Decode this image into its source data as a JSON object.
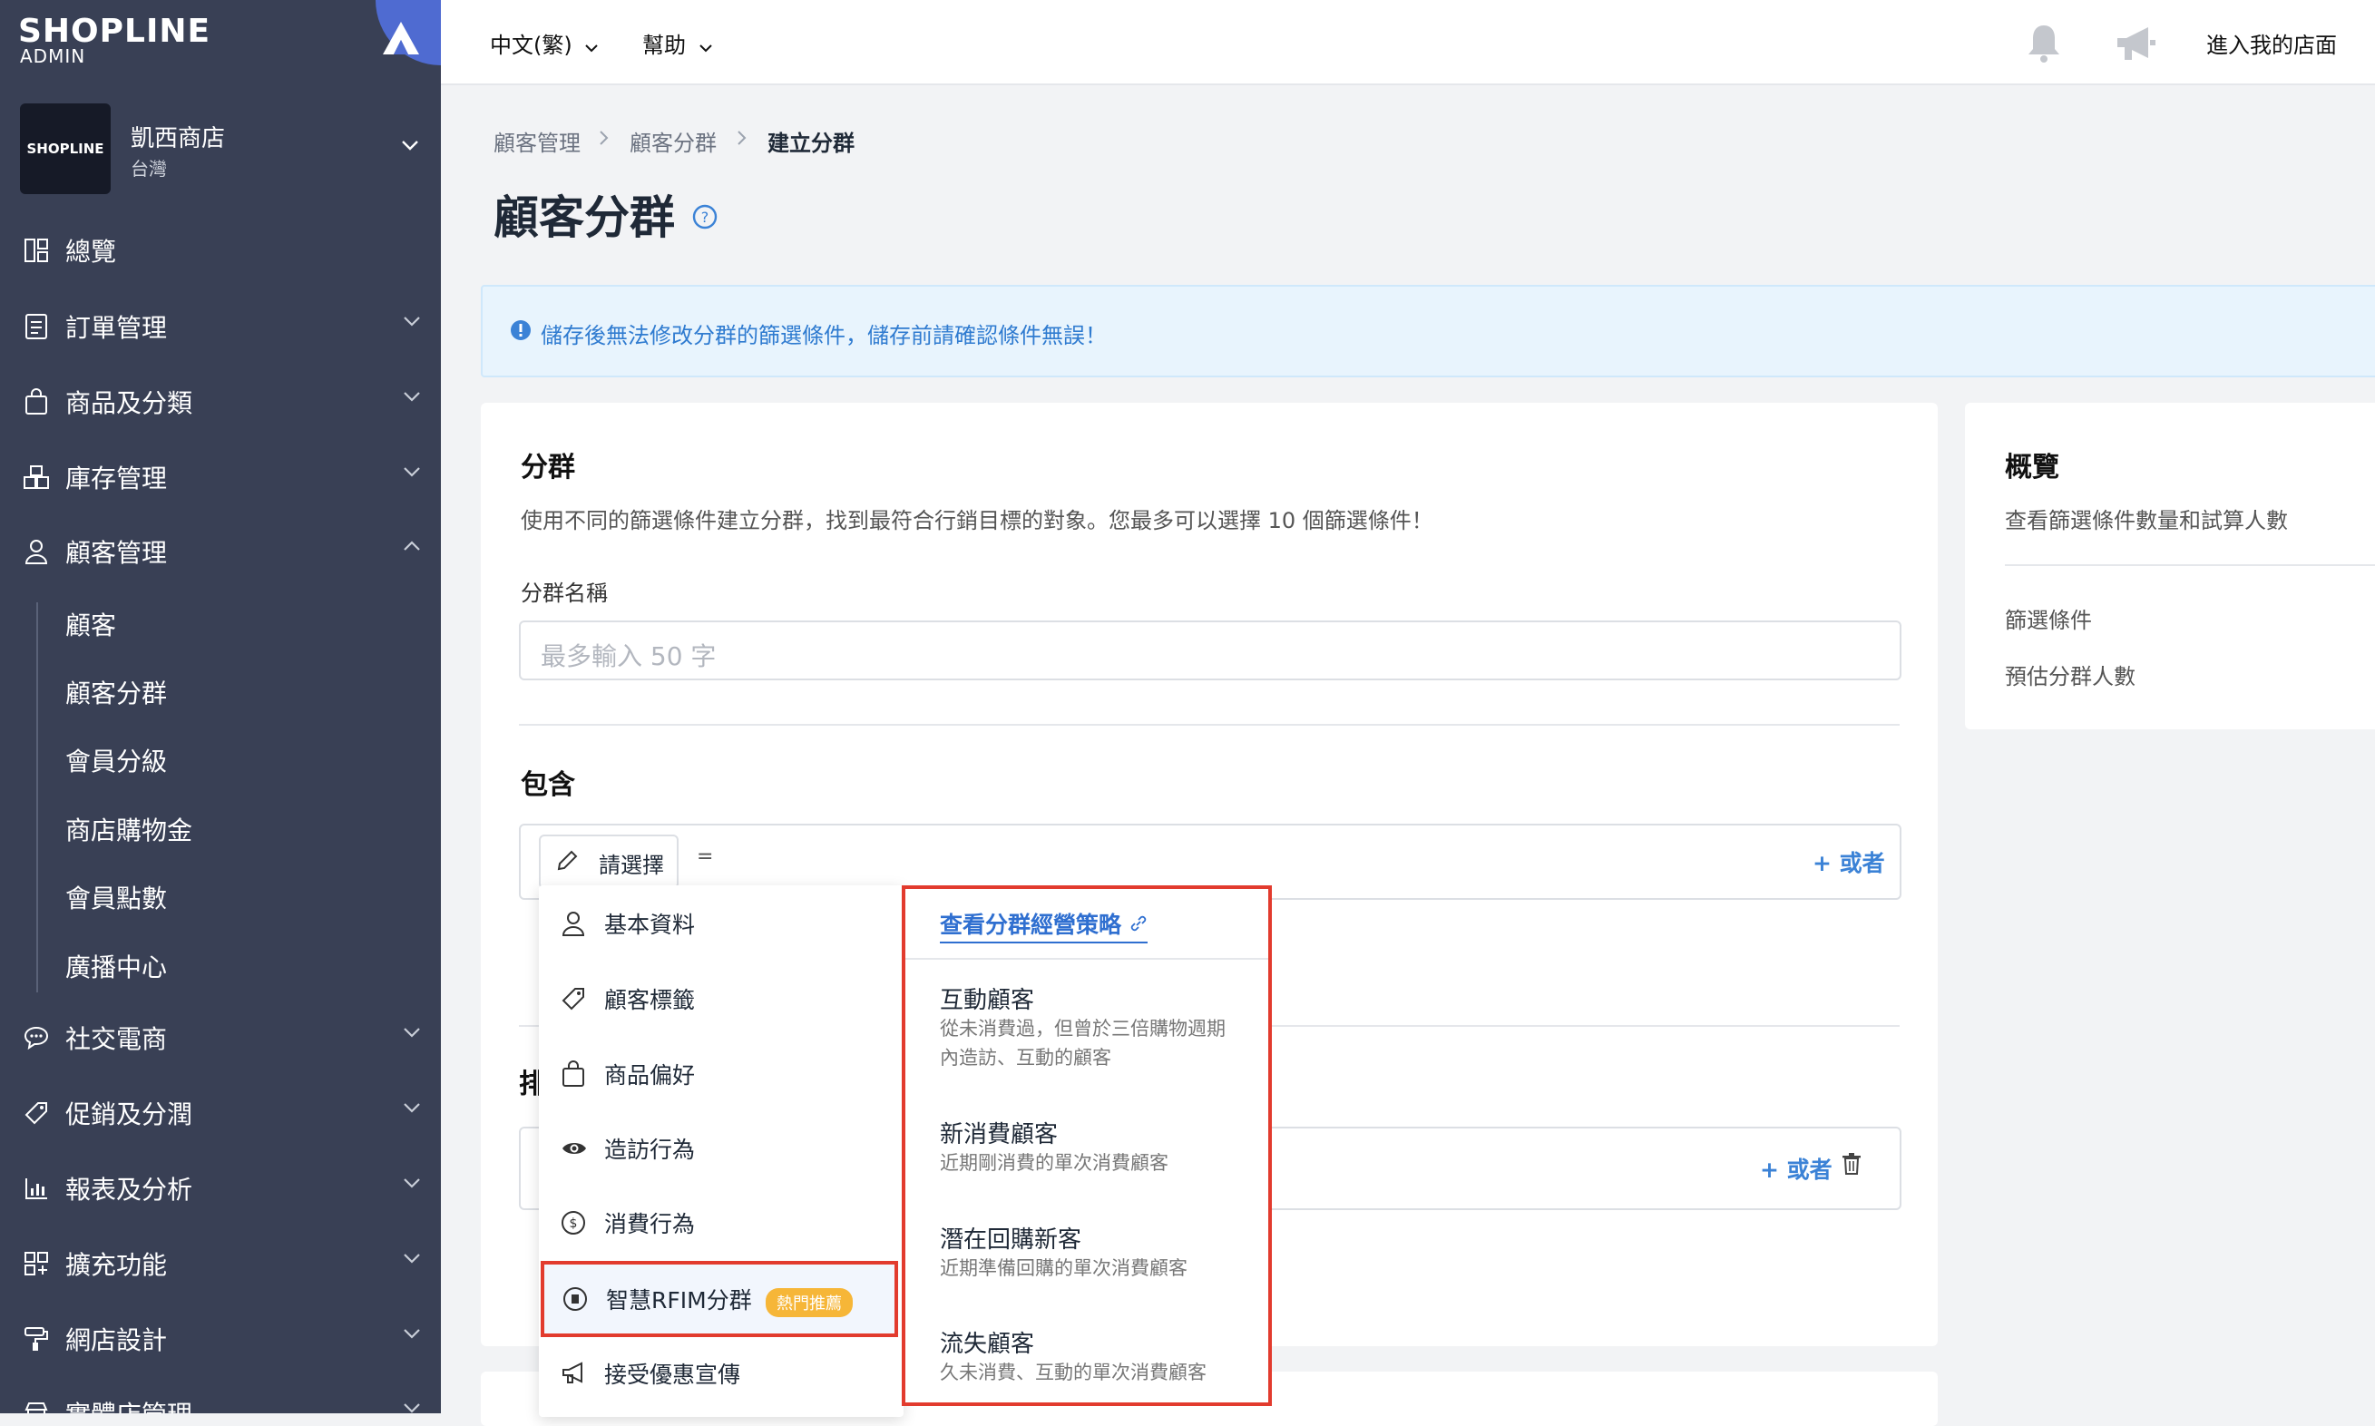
{
  "brand": {
    "logo": "SHOPLINE",
    "sub": "ADMIN",
    "store_logo": "SHOPLINE"
  },
  "store": {
    "name": "凱西商店",
    "region": "台灣"
  },
  "sidebar": {
    "items": [
      {
        "label": "總覽",
        "icon": "dashboard-icon"
      },
      {
        "label": "訂單管理",
        "icon": "order-icon"
      },
      {
        "label": "商品及分類",
        "icon": "bag-icon"
      },
      {
        "label": "庫存管理",
        "icon": "inventory-icon"
      },
      {
        "label": "顧客管理",
        "icon": "user-icon"
      },
      {
        "label": "社交電商",
        "icon": "chat-icon"
      },
      {
        "label": "促銷及分潤",
        "icon": "tag-icon"
      },
      {
        "label": "報表及分析",
        "icon": "chart-icon"
      },
      {
        "label": "擴充功能",
        "icon": "apps-icon"
      },
      {
        "label": "網店設計",
        "icon": "paint-roller-icon"
      },
      {
        "label": "實體店管理",
        "icon": "store-icon"
      }
    ],
    "sub_items": [
      "顧客",
      "顧客分群",
      "會員分級",
      "商店購物金",
      "會員點數",
      "廣播中心"
    ]
  },
  "topbar": {
    "language": "中文(繁)",
    "help": "幫助",
    "enter_store": "進入我的店面"
  },
  "breadcrumb": [
    "顧客管理",
    "顧客分群",
    "建立分群"
  ],
  "page": {
    "title": "顧客分群"
  },
  "alert": {
    "text": "儲存後無法修改分群的篩選條件，儲存前請確認條件無誤！"
  },
  "segment": {
    "heading": "分群",
    "description": "使用不同的篩選條件建立分群，找到最符合行銷目標的對象。您最多可以選擇 10 個篩選條件！",
    "name_label": "分群名稱",
    "name_placeholder": "最多輸入 50 字",
    "include_heading": "包含",
    "select_label": "請選擇",
    "equals": "=",
    "or_label": "+ 或者",
    "exclude_heading": "排"
  },
  "overview": {
    "heading": "概覽",
    "description": "查看篩選條件數量和試算人數",
    "filter_label": "篩選條件",
    "estimate_label": "預估分群人數"
  },
  "dropdown": {
    "items": [
      {
        "label": "基本資料",
        "icon": "user-icon"
      },
      {
        "label": "顧客標籤",
        "icon": "tag-icon"
      },
      {
        "label": "商品偏好",
        "icon": "bag-icon"
      },
      {
        "label": "造訪行為",
        "icon": "eye-icon"
      },
      {
        "label": "消費行為",
        "icon": "dollar-icon"
      },
      {
        "label": "智慧RFIM分群",
        "icon": "rfim-icon",
        "badge": "熱門推薦"
      },
      {
        "label": "接受優惠宣傳",
        "icon": "megaphone-icon"
      }
    ]
  },
  "submenu": {
    "link": "查看分群經營策略",
    "items": [
      {
        "title": "互動顧客",
        "desc_line1": "從未消費過，但曾於三倍購物週期",
        "desc_line2": "內造訪、互動的顧客"
      },
      {
        "title": "新消費顧客",
        "desc_line1": "近期剛消費的單次消費顧客",
        "desc_line2": ""
      },
      {
        "title": "潛在回購新客",
        "desc_line1": "近期準備回購的單次消費顧客",
        "desc_line2": ""
      },
      {
        "title": "流失顧客",
        "desc_line1": "久未消費、互動的單次消費顧客",
        "desc_line2": ""
      }
    ]
  },
  "colors": {
    "sidebar": "#394055",
    "accent": "#3b82d6",
    "highlight": "#e23b2e",
    "badge": "#f6b638"
  }
}
